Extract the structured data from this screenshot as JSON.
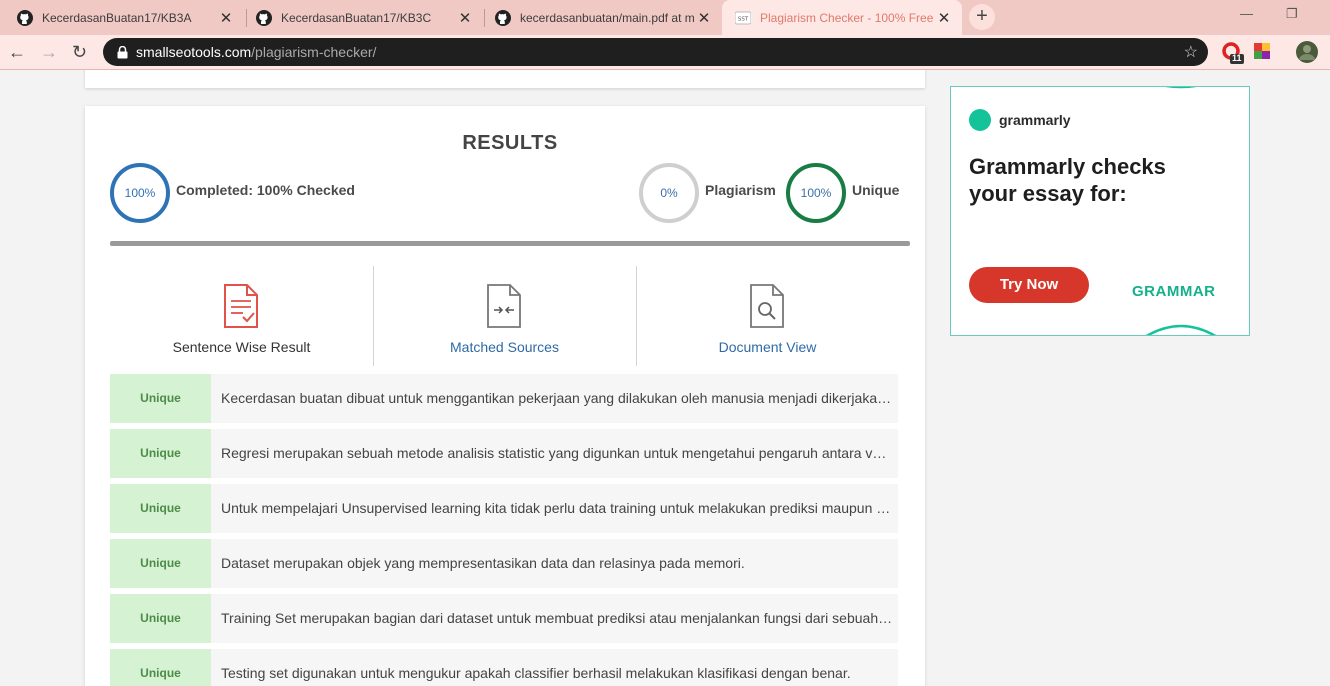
{
  "browser": {
    "tabs": [
      {
        "title": "KecerdasanBuatan17/KB3A",
        "icon": "github-icon"
      },
      {
        "title": "KecerdasanBuatan17/KB3C",
        "icon": "github-icon"
      },
      {
        "title": "kecerdasanbuatan/main.pdf at m",
        "icon": "github-icon"
      },
      {
        "title": "Plagiarism Checker - 100% Free (",
        "icon": "sst-icon"
      }
    ],
    "new_tab": "+",
    "url_domain": "smallseotools.com",
    "url_path": "/plagiarism-checker/",
    "ext_badge": "11"
  },
  "results": {
    "title": "RESULTS",
    "completed_pct": "100%",
    "completed_label": "Completed: 100% Checked",
    "plagiarism_pct": "0%",
    "plagiarism_label": "Plagiarism",
    "unique_pct": "100%",
    "unique_label": "Unique",
    "progress": 1.0
  },
  "view_tabs": [
    {
      "label": "Sentence Wise Result",
      "icon": "document-check-icon"
    },
    {
      "label": "Matched Sources",
      "icon": "compare-icon"
    },
    {
      "label": "Document View",
      "icon": "document-search-icon"
    }
  ],
  "rows": [
    {
      "badge": "Unique",
      "text": "Kecerdasan buatan dibuat untuk menggantikan pekerjaan yang dilakukan oleh manusia menjadi dikerjakan oleh mesin."
    },
    {
      "badge": "Unique",
      "text": "Regresi merupakan sebuah metode analisis statistic yang digunkan untuk mengetahui pengaruh antara variabel."
    },
    {
      "badge": "Unique",
      "text": "Untuk mempelajari Unsupervised learning kita tidak perlu data training untuk melakukan prediksi maupun klasifikasi."
    },
    {
      "badge": "Unique",
      "text": "Dataset merupakan objek yang mempresentasikan data dan relasinya pada memori."
    },
    {
      "badge": "Unique",
      "text": "Training Set merupakan bagian dari dataset untuk membuat prediksi atau menjalankan fungsi dari sebuah algoritma."
    },
    {
      "badge": "Unique",
      "text": "Testing set digunakan untuk mengukur apakah classifier berhasil melakukan klasifikasi dengan benar."
    }
  ],
  "ad": {
    "brand": "grammarly",
    "headline": "Grammarly checks your essay for:",
    "cta": "Try Now",
    "keyword": "GRAMMAR"
  }
}
